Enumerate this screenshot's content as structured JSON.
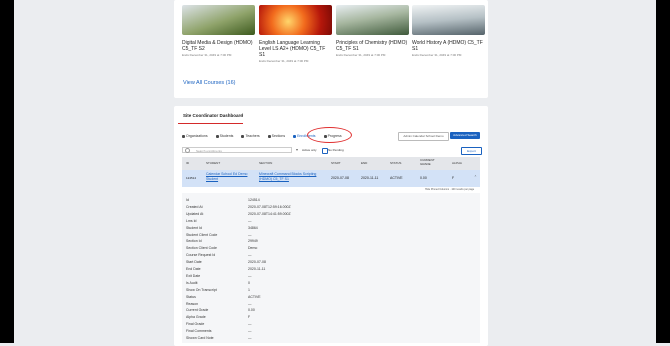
{
  "courses": [
    {
      "title": "Digital Media & Design (HDMO) C5_TF S2",
      "sub": "Ends December 31, 2049 at 7:00 PM",
      "color_a": "#4d6b2c",
      "color_b": "#b9c7d6"
    },
    {
      "title": "English Language Learning Level LS A2+ (HDMO) C5_TF S1",
      "sub": "Ends December 31, 2049 at 7:00 PM",
      "color_a": "#e3341a",
      "color_b": "#f7b32b"
    },
    {
      "title": "Principles of Chemistry (HDMO) C5_TF S1",
      "sub": "Ends December 31, 2049 at 7:00 PM",
      "color_a": "#3f5a3b",
      "color_b": "#c9d6de"
    },
    {
      "title": "World History A (HDMO) C5_TF S1",
      "sub": "Ends December 31, 2049 at 7:00 PM",
      "color_a": "#6f7f86",
      "color_b": "#d9dfe2"
    }
  ],
  "view_all": "View All Courses (16)",
  "dashboard_title": "Site Coordinator Dashboard",
  "tabs": [
    "Organizations",
    "Students",
    "Teachers",
    "Sections",
    "Enrollments",
    "Progress"
  ],
  "buttons": {
    "b1": "Admin Calendar School Demo",
    "b2": "Advanced Search"
  },
  "search_placeholder": "Search enrollments",
  "active_only": "Active only",
  "no_pending": "No Pending",
  "export": "Export",
  "table": {
    "headers": [
      "ID",
      "STUDENT",
      "SECTION",
      "START",
      "END",
      "STATUS",
      "CURRENT GRADE",
      "ALPHA"
    ],
    "row": {
      "id": "124514",
      "student": "Calendar School Ed Demo Student",
      "section": "Minecraft Command Blocks Scripting (HDMO) C5_TF S1",
      "start": "2020-07-08",
      "end": "2020-11-11",
      "status": "ACTIVE",
      "grade": "0.00",
      "alpha": "F"
    }
  },
  "legend": "Hide Pinned Columns · 100 results per page",
  "details": [
    {
      "label": "Id",
      "value": "124514"
    },
    {
      "label": "Created At",
      "value": "2020-07-08T12:59:16.000Z"
    },
    {
      "label": "Updated At",
      "value": "2020-07-08T14:41:59.000Z"
    },
    {
      "label": "Lms Id",
      "value": "—"
    },
    {
      "label": "Student Id",
      "value": "34864"
    },
    {
      "label": "Student Client Code",
      "value": "—"
    },
    {
      "label": "Section Id",
      "value": "29949"
    },
    {
      "label": "Section Client Code",
      "value": "Demo"
    },
    {
      "label": "Course Request Id",
      "value": "—"
    },
    {
      "label": "Start Date",
      "value": "2020-07-08"
    },
    {
      "label": "End Date",
      "value": "2020-11-11"
    },
    {
      "label": "Exit Date",
      "value": "—"
    },
    {
      "label": "Is Audit",
      "value": "0"
    },
    {
      "label": "Show On Transcript",
      "value": "1"
    },
    {
      "label": "Status",
      "value": "ACTIVE"
    },
    {
      "label": "Reason",
      "value": "—"
    },
    {
      "label": "Current Grade",
      "value": "0.00"
    },
    {
      "label": "Alpha Grade",
      "value": "F"
    },
    {
      "label": "Final Grade",
      "value": "—"
    },
    {
      "label": "Final Comments",
      "value": "—"
    },
    {
      "label": "Shown Card Note",
      "value": "—"
    }
  ]
}
